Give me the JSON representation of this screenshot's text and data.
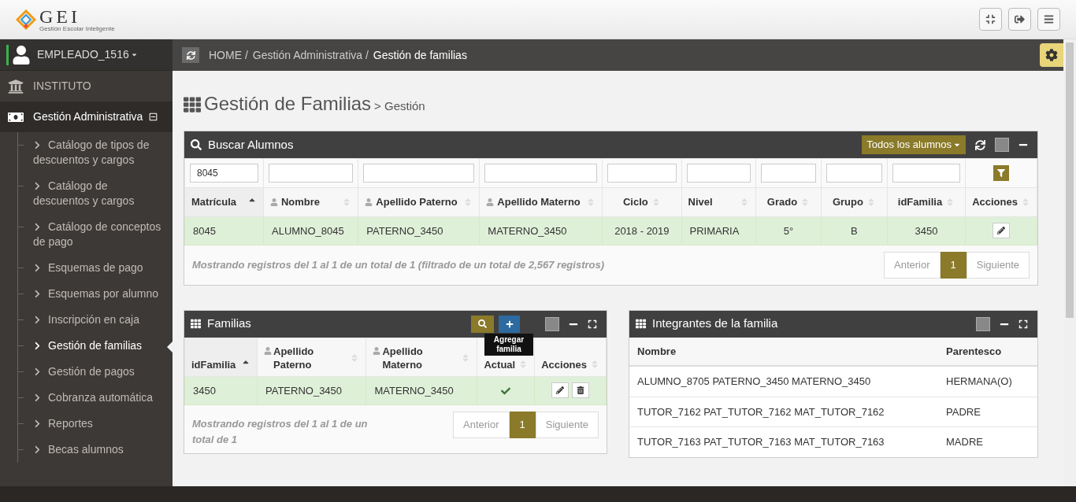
{
  "logo": {
    "text": "GEI",
    "subtitle": "Gestión Escolar Inteligente"
  },
  "user": {
    "name": "EMPLEADO_1516"
  },
  "sidebar": {
    "items": [
      {
        "label": "INSTITUTO",
        "expanded": false
      },
      {
        "label": "Gestión Administrativa",
        "expanded": true,
        "children": [
          {
            "label": "Catálogo de tipos de descuentos y cargos",
            "selected": false
          },
          {
            "label": "Catálogo de descuentos y cargos",
            "selected": false
          },
          {
            "label": "Catálogo de conceptos de pago",
            "selected": false
          },
          {
            "label": "Esquemas de pago",
            "selected": false
          },
          {
            "label": "Esquemas por alumno",
            "selected": false
          },
          {
            "label": "Inscripción en caja",
            "selected": false
          },
          {
            "label": "Gestión de familias",
            "selected": true
          },
          {
            "label": "Gestión de pagos",
            "selected": false
          },
          {
            "label": "Cobranza automática",
            "selected": false
          },
          {
            "label": "Reportes",
            "selected": false
          },
          {
            "label": "Becas alumnos",
            "selected": false
          }
        ]
      }
    ]
  },
  "breadcrumb": [
    "HOME /",
    "Gestión Administrativa /",
    "Gestión de familias"
  ],
  "page_title": {
    "title": "Gestión de Familias",
    "subtitle": "> Gestión"
  },
  "search_panel": {
    "title": "Buscar Alumnos",
    "filter_button": "Todos los alumnos",
    "filter_value": "8045",
    "columns": [
      {
        "label": "Matrícula",
        "sorted": true
      },
      {
        "label": "Nombre",
        "sorted": false
      },
      {
        "label": "Apellido Paterno",
        "sorted": false
      },
      {
        "label": "Apellido Materno",
        "sorted": false
      },
      {
        "label": "Ciclo",
        "sorted": false
      },
      {
        "label": "Nivel",
        "sorted": false
      },
      {
        "label": "Grado",
        "sorted": false
      },
      {
        "label": "Grupo",
        "sorted": false
      },
      {
        "label": "idFamilia",
        "sorted": false
      },
      {
        "label": "Acciones",
        "sorted": false
      }
    ],
    "rows": [
      {
        "selected": true,
        "cells": [
          "8045",
          "ALUMNO_8045",
          "PATERNO_3450",
          "MATERNO_3450",
          "2018 - 2019",
          "PRIMARIA",
          "5°",
          "B",
          "3450"
        ]
      }
    ],
    "info": "Mostrando registros del **1** al **1** de un total de **1** (filtrado de un total de 2,567 registros)",
    "pagination": {
      "prev": "Anterior",
      "pages": [
        {
          "label": "1",
          "selected": true
        }
      ],
      "next": "Siguiente"
    }
  },
  "families_panel": {
    "title": "Familias",
    "tooltip": "Agregar familia",
    "columns": [
      {
        "label": "idFamilia",
        "sorted": true
      },
      {
        "label": "Apellido Paterno",
        "sorted": false
      },
      {
        "label": "Apellido Materno",
        "sorted": false
      },
      {
        "label": "Actual",
        "sorted": false
      },
      {
        "label": "Acciones",
        "sorted": false
      }
    ],
    "rows": [
      {
        "selected": true,
        "current": true,
        "cells": [
          "3450",
          "PATERNO_3450",
          "MATERNO_3450"
        ]
      }
    ],
    "info": "Mostrando registros del **1** al **1** de un total de **1**",
    "pagination": {
      "prev": "Anterior",
      "pages": [
        {
          "label": "1",
          "selected": true
        }
      ],
      "next": "Siguiente"
    }
  },
  "members_panel": {
    "title": "Integrantes de la familia",
    "columns": [
      "Nombre",
      "Parentesco"
    ],
    "rows": [
      [
        "ALUMNO_8705 PATERNO_3450 MATERNO_3450",
        "HERMANA(O)"
      ],
      [
        "TUTOR_7162 PAT_TUTOR_7162 MAT_TUTOR_7162",
        "PADRE"
      ],
      [
        "TUTOR_7163 PAT_TUTOR_7163 MAT_TUTOR_7163",
        "MADRE"
      ]
    ]
  }
}
